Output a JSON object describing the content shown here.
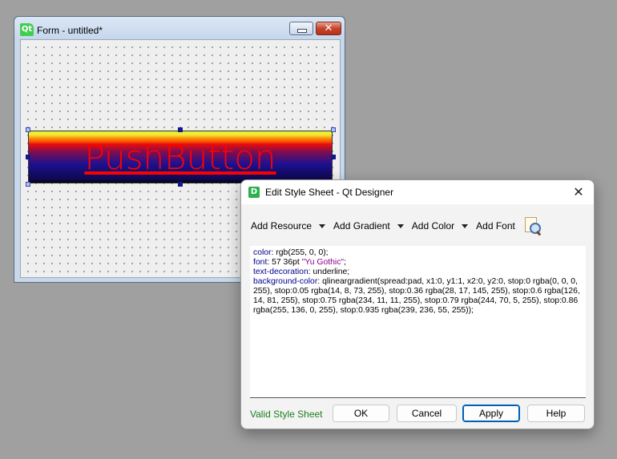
{
  "form_window": {
    "logo": "Qt",
    "title": "Form - untitled*",
    "close_glyph": "✕",
    "push_button": {
      "label": "PushButton"
    }
  },
  "dialog": {
    "logo": "D",
    "title": "Edit Style Sheet - Qt Designer",
    "close_glyph": "✕",
    "toolbar": {
      "add_resource": "Add Resource",
      "add_gradient": "Add Gradient",
      "add_color": "Add Color",
      "add_font": "Add Font",
      "preview_icon": "magnifier-document-icon"
    },
    "stylesheet": {
      "line1_prop": "color",
      "line1_val": ": rgb(255, 0, 0);",
      "line2_prop": "font",
      "line2_val": ": 57 36pt ",
      "line2_str": "\"Yu Gothic\"",
      "line2_end": ";",
      "line3_prop": "text-decoration",
      "line3_val": ": underline;",
      "line4_prop": "background-color",
      "line4_val": ": qlineargradient(spread:pad, x1:0, y1:1, x2:0, y2:0, stop:0 rgba(0, 0, 0, 255), stop:0.05 rgba(14, 8, 73, 255), stop:0.36 rgba(28, 17, 145, 255), stop:0.6 rgba(126, 14, 81, 255), stop:0.75 rgba(234, 11, 11, 255), stop:0.79 rgba(244, 70, 5, 255), stop:0.86 rgba(255, 136, 0, 255), stop:0.935 rgba(239, 236, 55, 255));"
    },
    "status": "Valid Style Sheet",
    "buttons": {
      "ok": "OK",
      "cancel": "Cancel",
      "apply": "Apply",
      "help": "Help"
    }
  }
}
